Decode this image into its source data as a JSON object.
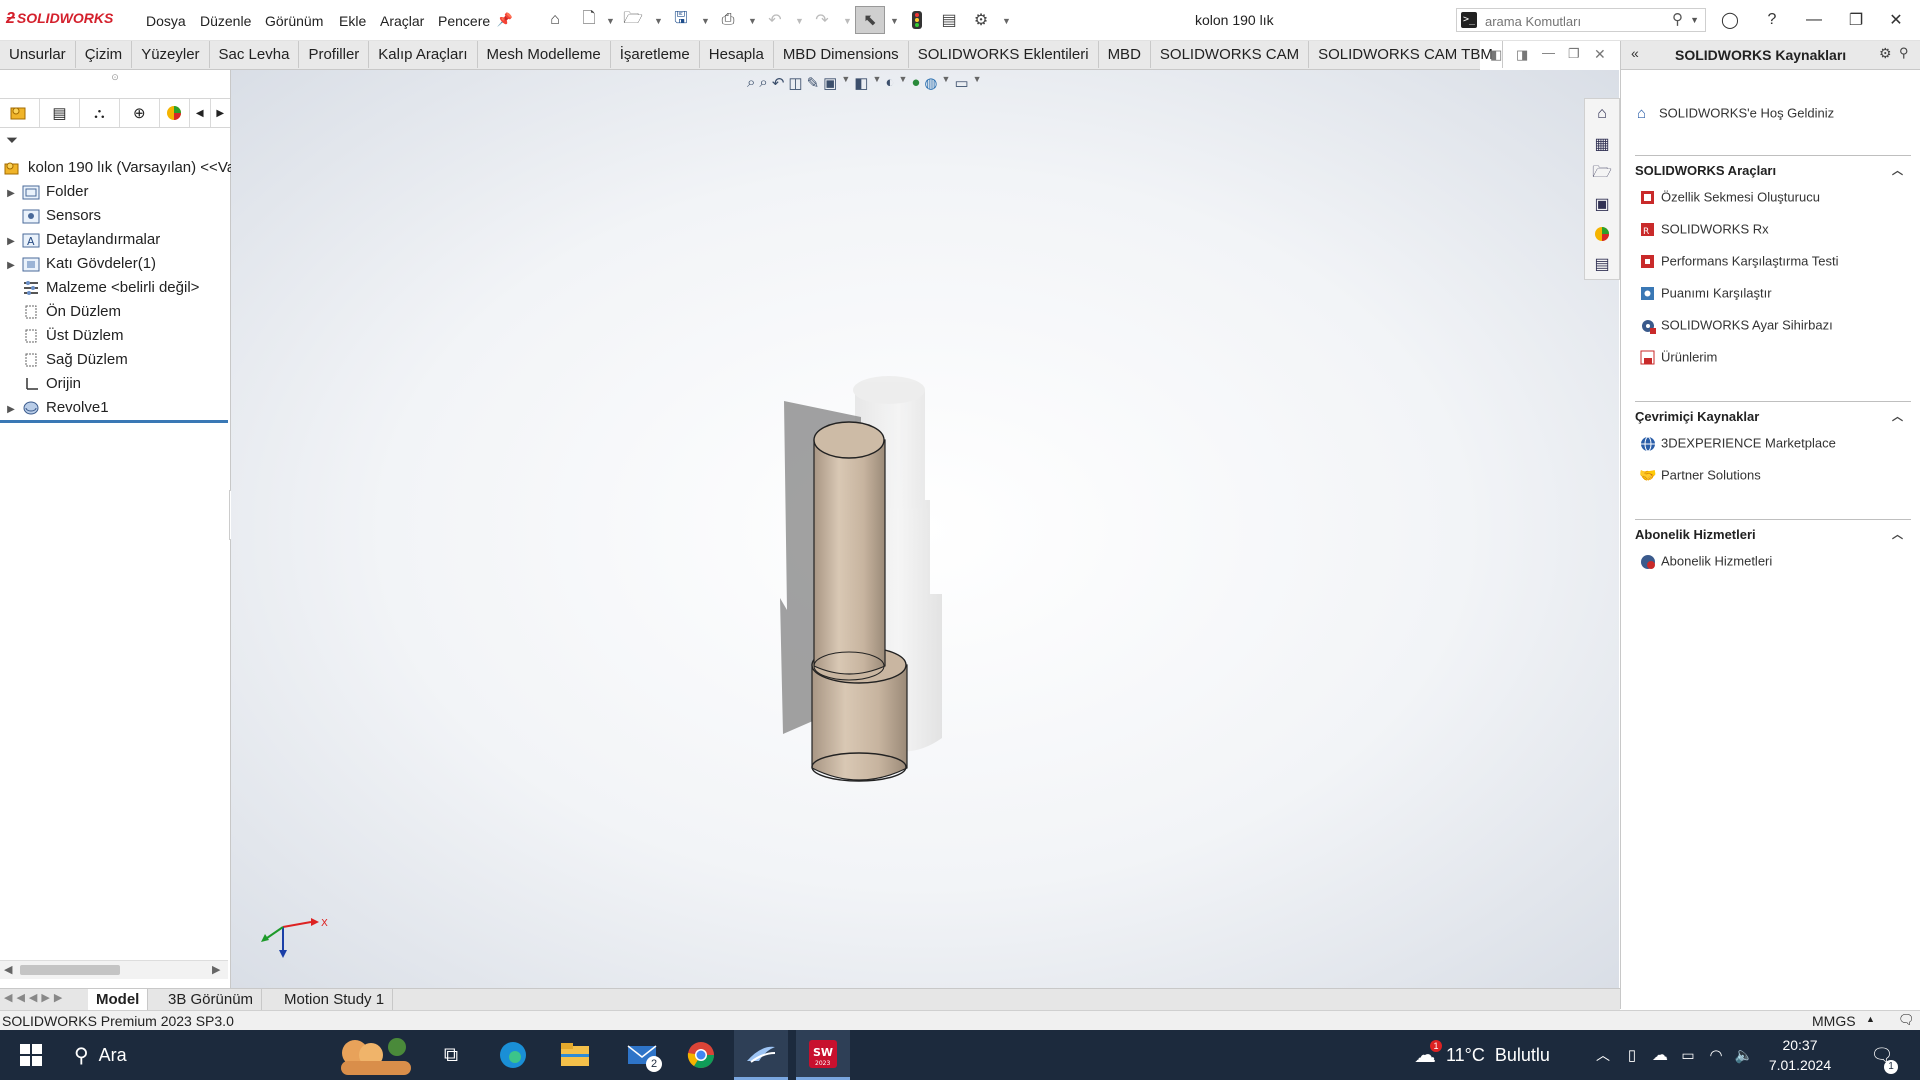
{
  "app": {
    "logo_text": "SOLIDWORKS",
    "document_title": "kolon 190 lık"
  },
  "menu": [
    "Dosya",
    "Düzenle",
    "Görünüm",
    "Ekle",
    "Araçlar",
    "Pencere"
  ],
  "search": {
    "placeholder": "arama Komutları"
  },
  "command_tabs": [
    "Unsurlar",
    "Çizim",
    "Yüzeyler",
    "Sac Levha",
    "Profiller",
    "Kalıp Araçları",
    "Mesh Modelleme",
    "İşaretleme",
    "Hesapla",
    "MBD Dimensions",
    "SOLIDWORKS Eklentileri",
    "MBD",
    "SOLIDWORKS CAM",
    "SOLIDWORKS CAM TBM"
  ],
  "feature_tree": {
    "root": "kolon 190 lık (Varsayılan) <<Va",
    "items": [
      {
        "label": "Folder",
        "expandable": true
      },
      {
        "label": "Sensors",
        "expandable": false
      },
      {
        "label": "Detaylandırmalar",
        "expandable": true
      },
      {
        "label": "Katı Gövdeler(1)",
        "expandable": true
      },
      {
        "label": "Malzeme <belirli değil>",
        "expandable": false
      },
      {
        "label": "Ön Düzlem",
        "expandable": false
      },
      {
        "label": "Üst Düzlem",
        "expandable": false
      },
      {
        "label": "Sağ Düzlem",
        "expandable": false
      },
      {
        "label": "Orijin",
        "expandable": false
      },
      {
        "label": "Revolve1",
        "expandable": true
      }
    ]
  },
  "task_pane": {
    "title": "SOLIDWORKS Kaynakları",
    "welcome": "SOLIDWORKS'e Hoş Geldiniz",
    "sections": [
      {
        "title": "SOLIDWORKS Araçları",
        "links": [
          "Özellik Sekmesi Oluşturucu",
          "SOLIDWORKS Rx",
          "Performans Karşılaştırma Testi",
          "Puanımı Karşılaştır",
          "SOLIDWORKS Ayar Sihirbazı",
          "Ürünlerim"
        ]
      },
      {
        "title": "Çevrimiçi Kaynaklar",
        "links": [
          "3DEXPERIENCE Marketplace",
          "Partner Solutions"
        ]
      },
      {
        "title": "Abonelik Hizmetleri",
        "links": [
          "Abonelik Hizmetleri"
        ]
      }
    ]
  },
  "bottom_tabs": [
    "Model",
    "3B Görünüm",
    "Motion Study 1"
  ],
  "status": {
    "left": "SOLIDWORKS Premium 2023 SP3.0",
    "units": "MMGS"
  },
  "triad": {
    "x_label": "X"
  },
  "taskbar": {
    "search_label": "Ara",
    "mail_badge": "2",
    "weather_badge": "1",
    "weather": "11°C  Bulutlu",
    "time": "20:37",
    "date": "7.01.2024",
    "notif_count": "1",
    "sw_year": "2023"
  },
  "colors": {
    "accent": "#d4202c",
    "part": "#c8b7a3",
    "taskbar": "#1c2a3d",
    "selection": "#3a78b5"
  }
}
